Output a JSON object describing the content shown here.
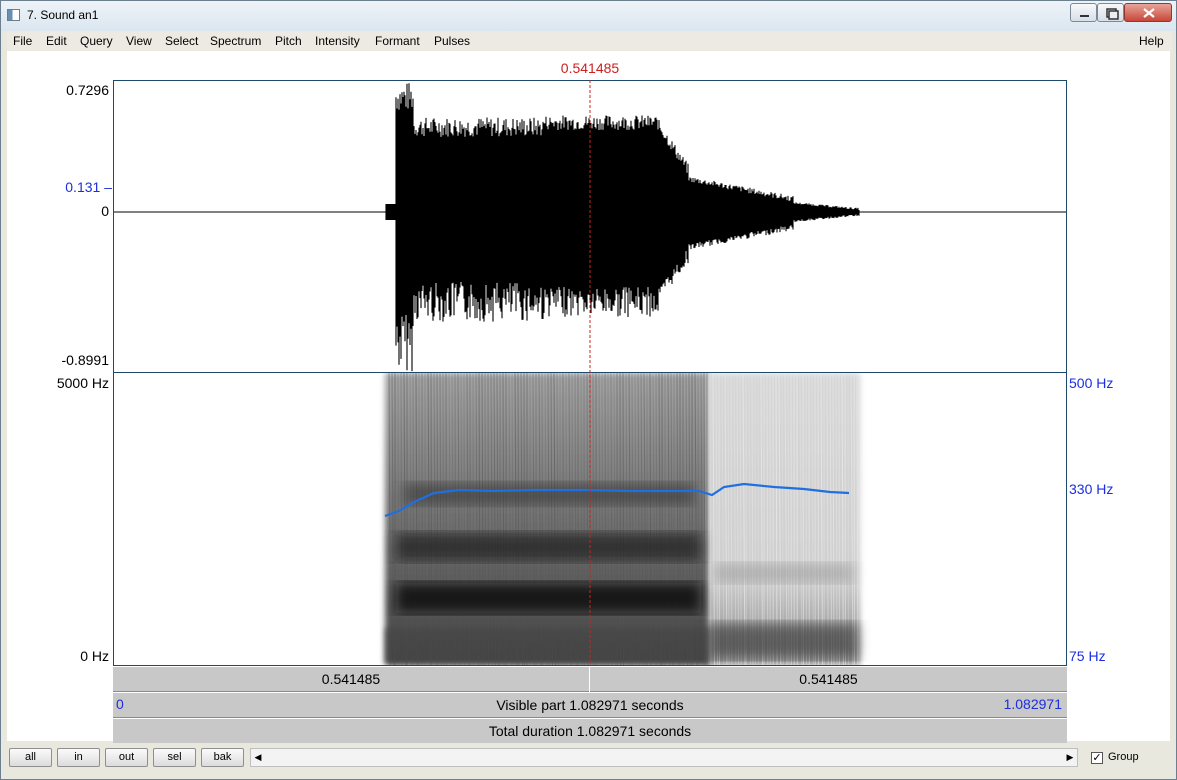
{
  "window": {
    "title": "7. Sound an1"
  },
  "menu": {
    "items": [
      "File",
      "Edit",
      "Query",
      "View",
      "Select",
      "Spectrum",
      "Pitch",
      "Intensity",
      "Formant",
      "Pulses"
    ],
    "help": "Help"
  },
  "cursor": {
    "time_label": "0.541485",
    "time": 0.541485
  },
  "waveform": {
    "max_label": "0.7296",
    "cursor_value_label": "0.131",
    "zero_label": "0",
    "min_label": "-0.8991"
  },
  "spectrogram": {
    "freq_top_label": "5000 Hz",
    "freq_bottom_label": "0 Hz",
    "pitch_top_label": "500 Hz",
    "pitch_cursor_label": "330 Hz",
    "pitch_bottom_label": "75 Hz"
  },
  "time_bars": {
    "left_segment": "0.541485",
    "right_segment": "0.541485",
    "visible_start": "0",
    "visible_part": "Visible part 1.082971 seconds",
    "visible_end": "1.082971",
    "total_duration": "Total duration 1.082971 seconds"
  },
  "bottom": {
    "buttons": [
      "all",
      "in",
      "out",
      "sel",
      "bak"
    ],
    "group_label": "Group",
    "group_checked": true
  },
  "colors": {
    "cursor": "#cc2020",
    "axis_blue": "#1b2ee0",
    "pitch_line": "#1f6fe0"
  }
}
